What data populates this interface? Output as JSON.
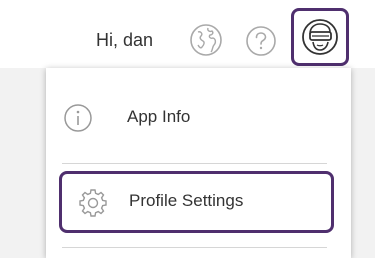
{
  "header": {
    "greeting": "Hi, dan",
    "icons": [
      "globe-icon",
      "help-icon",
      "vr-avatar-icon"
    ]
  },
  "menu": {
    "items": [
      {
        "label": "App Info",
        "icon": "info-icon"
      },
      {
        "label": "Profile Settings",
        "icon": "gear-icon"
      }
    ]
  },
  "colors": {
    "highlight_border": "#4f2f6e",
    "icon_gray": "#a9a9a9",
    "text": "#333333"
  }
}
